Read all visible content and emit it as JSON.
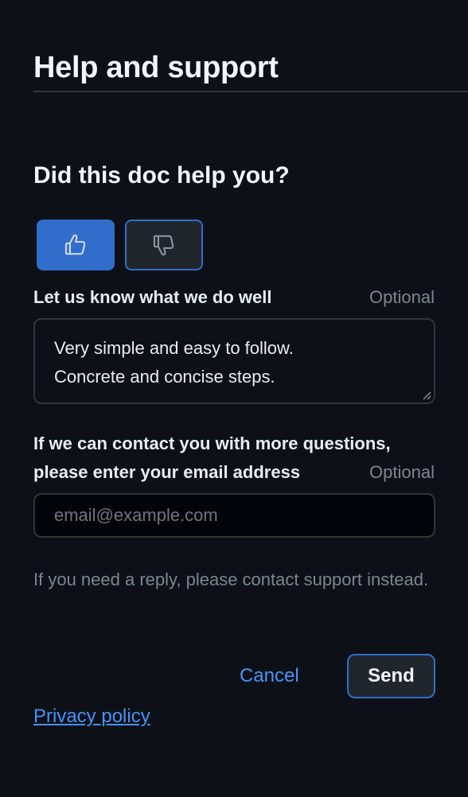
{
  "header": {
    "title": "Help and support"
  },
  "feedback": {
    "question": "Did this doc help you?",
    "thumbs_up_icon": "thumbs-up-icon",
    "thumbs_down_icon": "thumbs-down-icon",
    "selected": "thumbs-up"
  },
  "comment": {
    "label": "Let us know what we do well",
    "optional": "Optional",
    "lines": [
      "Very simple and easy to follow.",
      "Concrete and concise steps."
    ]
  },
  "contact": {
    "label_line1": "If we can contact you with more questions,",
    "label_line2": "please enter your email address",
    "optional": "Optional",
    "placeholder": "email@example.com",
    "value": ""
  },
  "hint": "If you need a reply, please contact support instead.",
  "actions": {
    "cancel": "Cancel",
    "send": "Send"
  },
  "footer": {
    "privacy": "Privacy policy"
  },
  "colors": {
    "background": "#0d1117",
    "accent": "#316dca",
    "link": "#4493f8"
  }
}
